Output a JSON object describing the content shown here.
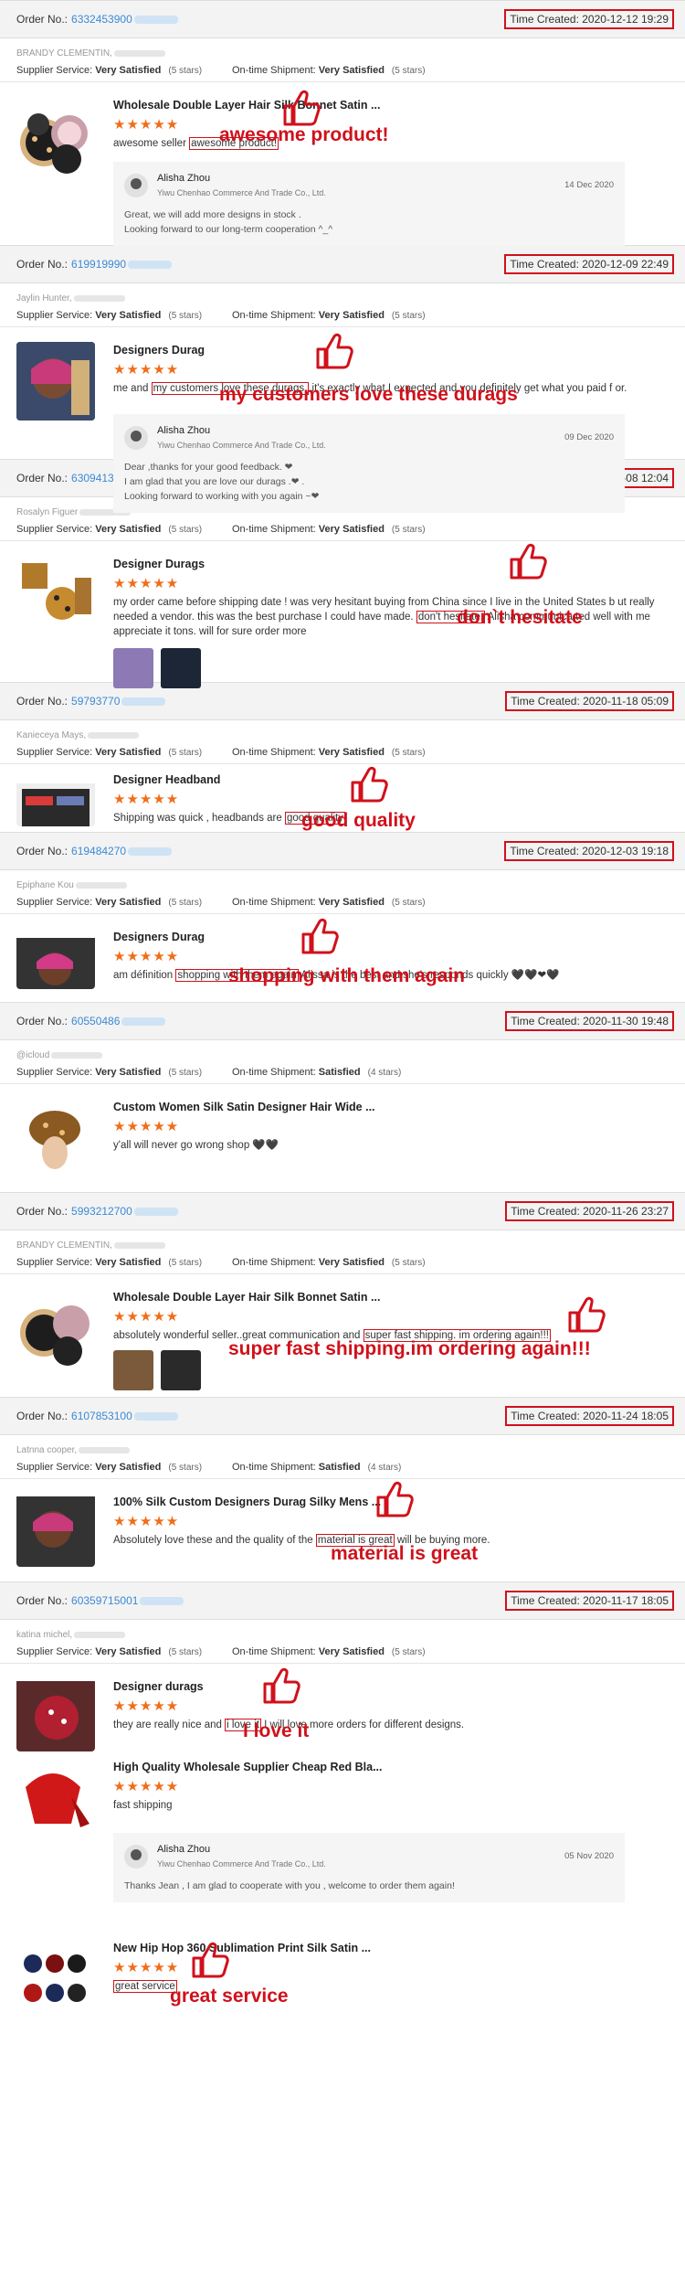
{
  "labels": {
    "order_no": "Order No.:",
    "supplier_service": "Supplier Service:",
    "ontime_shipment": "On-time Shipment:"
  },
  "orders": [
    {
      "order_no": "6332453900",
      "time": "Time Created: 2020-12-12 19:29",
      "buyer": "BRANDY CLEMENTIN,",
      "supplier": "Very Satisfied",
      "supplier_stars": "(5 stars)",
      "shipment": "Very Satisfied",
      "shipment_stars": "(5 stars)",
      "product": "Wholesale Double Layer Hair Silk Bonnet Satin ...",
      "stars": "★★★★★",
      "review_before": "awesome seller",
      "review_hl": "awesome product!",
      "review_after": "",
      "annotation": "awesome product!",
      "reply": {
        "name": "Alisha Zhou",
        "company": "Yiwu Chenhao Commerce And Trade Co., Ltd.",
        "date": "14 Dec 2020",
        "line1": "Great, we will add more designs in stock .",
        "line2": "Looking forward to our long-term cooperation ^_^",
        "line3": ""
      }
    },
    {
      "order_no": "619919990",
      "time": "Time Created: 2020-12-09 22:49",
      "buyer": "Jaylin Hunter,",
      "supplier": "Very Satisfied",
      "supplier_stars": "(5 stars)",
      "shipment": "Very Satisfied",
      "shipment_stars": "(5 stars)",
      "product": "Designers Durag",
      "stars": "★★★★★",
      "review_before": "me and",
      "review_hl": "my customers love these durags.",
      "review_after": "it's exactly what I expected and you definitely get what you paid f or.",
      "annotation": "my customers love these durags",
      "reply": {
        "name": "Alisha Zhou",
        "company": "Yiwu Chenhao Commerce And Trade Co., Ltd.",
        "date": "09 Dec 2020",
        "line1": "Dear ,thanks for your good feedback. ❤",
        "line2": "I am glad that you are love our durags .❤ .",
        "line3": "Looking forward to working with you again ~❤"
      }
    },
    {
      "order_no": "630941305",
      "time": "Time Created: 2020-12-08 12:04",
      "buyer": "Rosalyn Figuer",
      "supplier": "Very Satisfied",
      "supplier_stars": "(5 stars)",
      "shipment": "Very Satisfied",
      "shipment_stars": "(5 stars)",
      "product": "Designer Durags",
      "stars": "★★★★★",
      "review_before": "my order came before shipping date ! was very hesitant buying from China since I live in the United States b ut really needed a vendor. this was the best purchase I could have made.",
      "review_hl": "don't hesitate.",
      "review_after": "Alisha communica ted well with me appreciate it tons. will for sure order more",
      "annotation": "don`t hesitate"
    },
    {
      "order_no": "59793770",
      "time": "Time Created: 2020-11-18 05:09",
      "buyer": "Kanieceya Mays,",
      "supplier": "Very Satisfied",
      "supplier_stars": "(5 stars)",
      "shipment": "Very Satisfied",
      "shipment_stars": "(5 stars)",
      "product": "Designer Headband",
      "stars": "★★★★★",
      "review_before": "Shipping was quick , headbands are",
      "review_hl": "good quality",
      "review_after": "",
      "annotation": "good quality"
    },
    {
      "order_no": "619484270",
      "time": "Time Created: 2020-12-03 19:18",
      "buyer": "Epiphane Kou",
      "supplier": "Very Satisfied",
      "supplier_stars": "(5 stars)",
      "shipment": "Very Satisfied",
      "shipment_stars": "(5 stars)",
      "product": "Designers Durag",
      "stars": "★★★★★",
      "review_before": "am définition",
      "review_hl": "shopping with them again",
      "review_after": "Alissa is the best and she's responds quickly 🖤🖤❤🖤",
      "annotation": "shopping with them again"
    },
    {
      "order_no": "60550486",
      "time": "Time Created: 2020-11-30 19:48",
      "buyer": "@icloud",
      "supplier": "Very Satisfied",
      "supplier_stars": "(5 stars)",
      "shipment": "Satisfied",
      "shipment_stars": "(4 stars)",
      "product": "Custom Women Silk Satin Designer Hair Wide ...",
      "stars": "★★★★★",
      "review_before": "y'all will never go wrong shop 🖤🖤",
      "review_hl": "",
      "review_after": "",
      "annotation": ""
    },
    {
      "order_no": "5993212700",
      "time": "Time Created: 2020-11-26 23:27",
      "buyer": "BRANDY CLEMENTIN,",
      "supplier": "Very Satisfied",
      "supplier_stars": "(5 stars)",
      "shipment": "Very Satisfied",
      "shipment_stars": "(5 stars)",
      "product": "Wholesale Double Layer Hair Silk Bonnet Satin ...",
      "stars": "★★★★★",
      "review_before": "absolutely wonderful seller..great communication and",
      "review_hl": "super fast shipping. im ordering again!!!",
      "review_after": "",
      "annotation": "super fast shipping.im ordering again!!!"
    },
    {
      "order_no": "6107853100",
      "time": "Time Created: 2020-11-24 18:05",
      "buyer": "Latnna cooper,",
      "supplier": "Very Satisfied",
      "supplier_stars": "(5 stars)",
      "shipment": "Satisfied",
      "shipment_stars": "(4 stars)",
      "product": "100% Silk Custom Designers Durag Silky Mens ...",
      "stars": "★★★★★",
      "review_before": "Absolutely love these and the quality of the",
      "review_hl": "material is great",
      "review_after": "will be buying more.",
      "annotation": "material is great"
    },
    {
      "order_no": "60359715001",
      "time": "Time Created: 2020-11-17 18:05",
      "buyer": "katina michel,",
      "supplier": "Very Satisfied",
      "supplier_stars": "(5 stars)",
      "shipment": "Very Satisfied",
      "shipment_stars": "(5 stars)",
      "products": [
        {
          "product": "Designer durags",
          "stars": "★★★★★",
          "review_before": "they are really nice and",
          "review_hl": "i love it",
          "review_after": "I will love more orders for different designs.",
          "annotation": "I love it"
        },
        {
          "product": "High Quality Wholesale Supplier Cheap Red Bla...",
          "stars": "★★★★★",
          "review_before": "fast shipping",
          "review_hl": "",
          "review_after": "",
          "annotation": "",
          "reply": {
            "name": "Alisha Zhou",
            "company": "Yiwu Chenhao Commerce And Trade Co., Ltd.",
            "date": "05 Nov 2020",
            "line1": "Thanks Jean , I am glad to cooperate with you , welcome to order them again!"
          }
        },
        {
          "product": "New Hip Hop 360 Sublimation Print Silk Satin ...",
          "stars": "★★★★★",
          "review_before": "",
          "review_hl": "great service",
          "review_after": "",
          "annotation": "great service"
        }
      ]
    }
  ],
  "colors": {
    "accent_red": "#d0111b",
    "star_orange": "#f06d1a",
    "link_blue": "#3a8ad6",
    "header_gray": "#f3f3f3"
  },
  "icons": {
    "thumbs_up": "thumbs-up-icon",
    "avatar": "supplier-avatar"
  }
}
